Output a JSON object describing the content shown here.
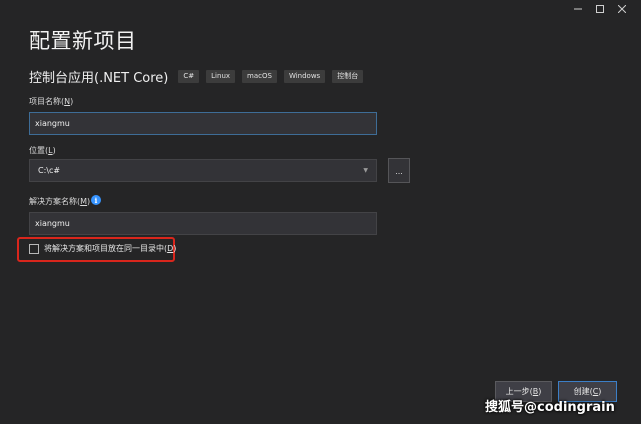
{
  "window": {
    "minimize_icon": "minimize-icon",
    "maximize_icon": "maximize-icon",
    "close_icon": "close-icon"
  },
  "title": "配置新项目",
  "template": {
    "name": "控制台应用(.NET Core)",
    "tags": [
      "C#",
      "Linux",
      "macOS",
      "Windows",
      "控制台"
    ]
  },
  "project_name": {
    "label": "项目名称",
    "hotkey": "N",
    "value": "xiangmu"
  },
  "location": {
    "label": "位置",
    "hotkey": "L",
    "value": "C:\\c#",
    "browse_label": "..."
  },
  "solution_name": {
    "label": "解决方案名称",
    "hotkey": "M",
    "value": "xiangmu",
    "info_icon": "info-icon"
  },
  "same_directory": {
    "label": "将解决方案和项目放在同一目录中",
    "hotkey": "D",
    "checked": false
  },
  "buttons": {
    "back_label": "上一步",
    "back_hotkey": "B",
    "create_label": "创建",
    "create_hotkey": "C"
  },
  "watermark": "搜狐号@codingrain",
  "colors": {
    "background": "#252526",
    "input_bg": "#333337",
    "focus_border": "#3e6d97",
    "primary_border": "#3c7fc7",
    "highlight_red": "#d9261c",
    "info_blue": "#3794ff"
  }
}
